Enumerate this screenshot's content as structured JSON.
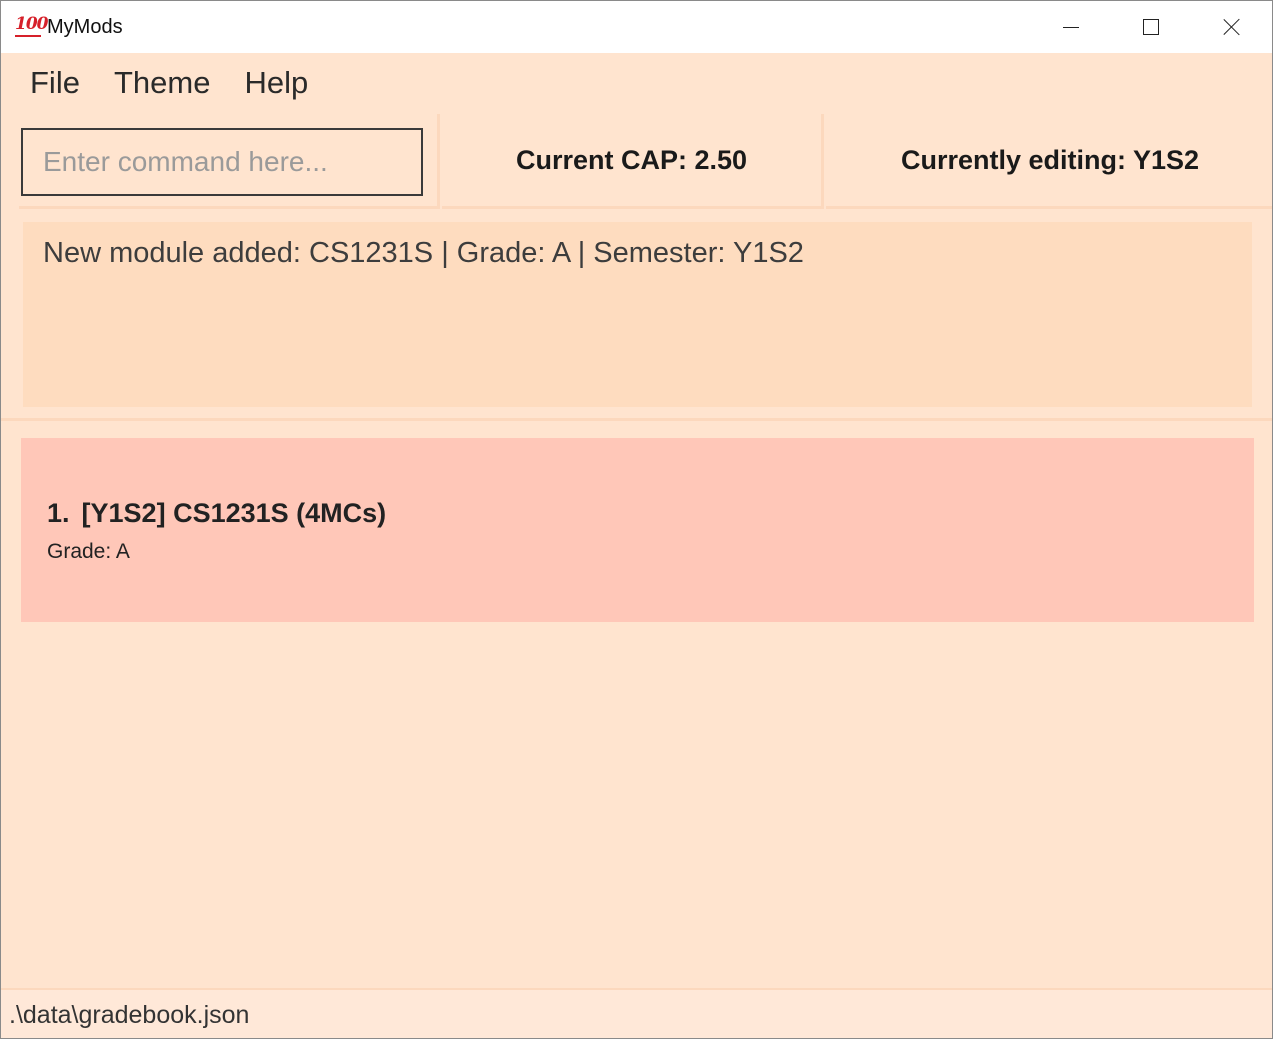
{
  "window": {
    "title": "MyMods",
    "icon": "hundred-points-icon"
  },
  "menu": {
    "items": [
      "File",
      "Theme",
      "Help"
    ]
  },
  "command": {
    "placeholder": "Enter command here...",
    "value": ""
  },
  "status": {
    "cap": "Current CAP: 2.50",
    "editing": "Currently editing: Y1S2"
  },
  "result": {
    "message": "New module added: CS1231S | Grade: A | Semester: Y1S2"
  },
  "modules": [
    {
      "index": "1.",
      "title": "[Y1S2] CS1231S (4MCs)",
      "grade": "Grade: A"
    }
  ],
  "statusbar": {
    "path": ".\\data\\gradebook.json"
  },
  "colors": {
    "background": "#ffe4cf",
    "result_box": "#fedcbf",
    "module_card": "#ffc7b8"
  }
}
